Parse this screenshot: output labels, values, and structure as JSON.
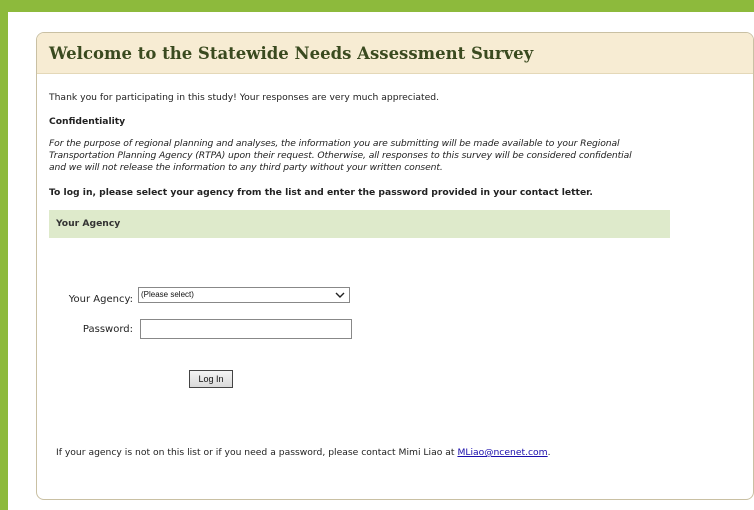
{
  "header": {
    "title": "Welcome to the Statewide Needs Assessment Survey"
  },
  "intro": {
    "text": "Thank you for participating in this study! Your responses are very much appreciated."
  },
  "confidentiality": {
    "heading": "Confidentiality",
    "lines": [
      "For the purpose of regional planning and analyses, the information you are submitting will be made available to your Regional",
      "Transportation Planning Agency (RTPA) upon their request. Otherwise, all responses to this survey will be considered confidential",
      "and we will not release the information to any third party without your written consent."
    ]
  },
  "login": {
    "instructions": "To log in, please select your agency from the list and enter the password provided in your contact letter.",
    "section_title": "Your Agency",
    "agency_label": "Your Agency:",
    "agency_selected": "(Please select)",
    "password_label": "Password:",
    "password_value": "",
    "button_label": "Log In"
  },
  "contact": {
    "text_before": "If your agency is not on this list or if you need a password, please contact Mimi Liao at ",
    "email_link": "MLiao@ncenet.com",
    "text_after": "."
  },
  "colors": {
    "outer_background": "#8dba3c",
    "header_background": "#f7ecd3",
    "section_bar": "#deeacb",
    "link": "#1a0dab"
  }
}
